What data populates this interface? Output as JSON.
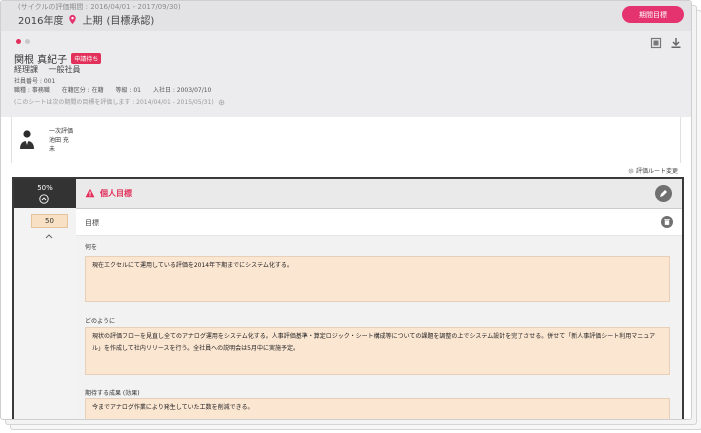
{
  "header": {
    "cycle_note": "(サイクルの評価期間 : 2016/04/01 - 2017/09/30)",
    "year": "2016年度",
    "period_label": "上期",
    "stage": "(目標承認)",
    "action_button": "期間目標"
  },
  "profile": {
    "name": "関根 真紀子",
    "status_tag": "申請待ち",
    "department": "経理課",
    "position": "一般社員",
    "employee_no": "社員番号 : 001",
    "job_type": "職種 : 事務職",
    "employment": "在籍区分 : 在籍",
    "grade": "等級 : 01",
    "hire_date": "入社日 : 2003/07/10",
    "period_note": "(このシートは次の期間の目標を評価します : 2014/04/01 - 2015/05/31)"
  },
  "evaluator": {
    "role": "一次評価",
    "name": "池田 充",
    "status": "未"
  },
  "route_change": "評価ルート変更",
  "goal_section": {
    "weight_percent": "50%",
    "weight_value": "50",
    "title": "個人目標",
    "goal_label": "目標",
    "fields": [
      {
        "label": "何を",
        "value": "現在エクセルにて運用している評価を2014年下期までにシステム化する。"
      },
      {
        "label": "どのように",
        "value": "現状の評価フローを見直し全てのアナログ運用をシステム化する。人事評価基準・算定ロジック・シート構成等についての課題を調整の上でシステム設計を完了させる。併せて「新人事評価シート利用マニュアル」を作成して社内リリースを行う。全社員への説明会は5月中に実施予定。"
      },
      {
        "label": "期待する成果 (効果)",
        "value": "今までアナログ作業により発生していた工数を削減できる。"
      }
    ]
  },
  "colors": {
    "accent": "#e5336f",
    "field_bg": "#fbe6d2",
    "dark": "#333333"
  },
  "icons": [
    "map-pin-icon",
    "print-icon",
    "download-icon",
    "gear-icon",
    "warning-icon",
    "pencil-icon",
    "trash-icon",
    "chevron-up-circle-icon",
    "caret-up-icon"
  ]
}
